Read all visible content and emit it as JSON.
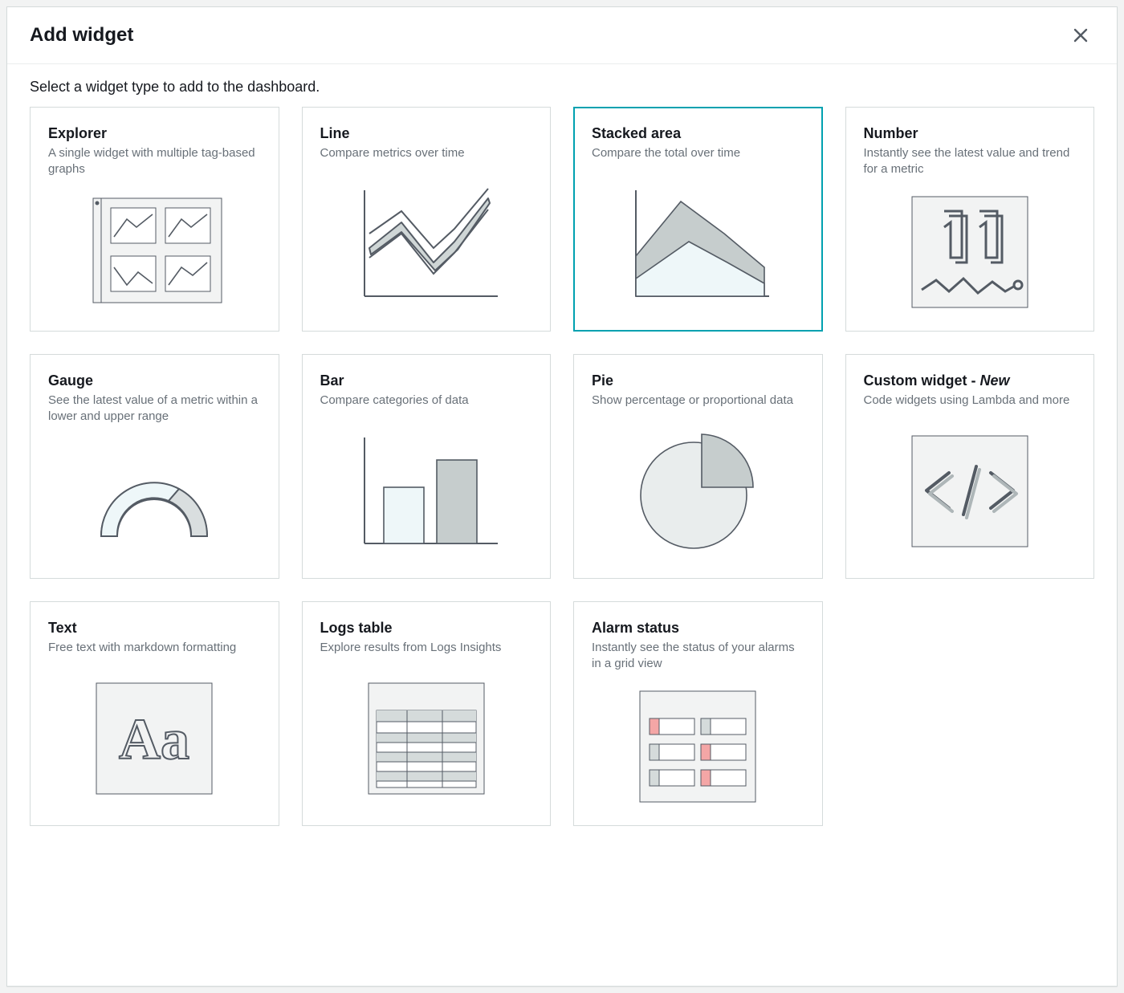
{
  "modal": {
    "title": "Add widget",
    "subtitle": "Select a widget type to add to the dashboard."
  },
  "widgets": [
    {
      "id": "explorer",
      "title": "Explorer",
      "desc": "A single widget with multiple tag-based graphs",
      "selected": false
    },
    {
      "id": "line",
      "title": "Line",
      "desc": "Compare metrics over time",
      "selected": false
    },
    {
      "id": "stacked-area",
      "title": "Stacked area",
      "desc": "Compare the total over time",
      "selected": true
    },
    {
      "id": "number",
      "title": "Number",
      "desc": "Instantly see the latest value and trend for a metric",
      "selected": false
    },
    {
      "id": "gauge",
      "title": "Gauge",
      "desc": "See the latest value of a metric within a lower and upper range",
      "selected": false
    },
    {
      "id": "bar",
      "title": "Bar",
      "desc": "Compare categories of data",
      "selected": false
    },
    {
      "id": "pie",
      "title": "Pie",
      "desc": "Show percentage or proportional data",
      "selected": false
    },
    {
      "id": "custom",
      "title": "Custom widget - ",
      "title_suffix": "New",
      "desc": "Code widgets using Lambda and more",
      "selected": false
    },
    {
      "id": "text",
      "title": "Text",
      "desc": "Free text with markdown formatting",
      "selected": false
    },
    {
      "id": "logs-table",
      "title": "Logs table",
      "desc": "Explore results from Logs Insights",
      "selected": false
    },
    {
      "id": "alarm-status",
      "title": "Alarm status",
      "desc": "Instantly see the status of your alarms in a grid view",
      "selected": false
    }
  ]
}
